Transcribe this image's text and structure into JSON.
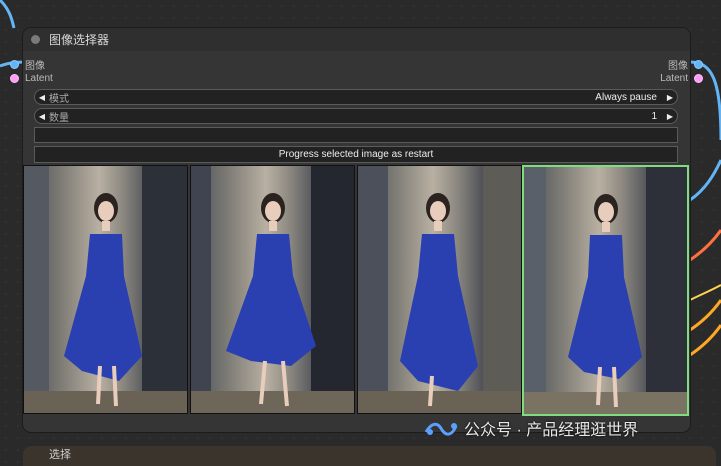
{
  "node": {
    "title": "图像选择器",
    "inputs": [
      {
        "label": "图像",
        "type": "image"
      },
      {
        "label": "Latent",
        "type": "latent"
      }
    ],
    "outputs": [
      {
        "label": "图像",
        "type": "image"
      },
      {
        "label": "Latent",
        "type": "latent"
      }
    ],
    "widgets": {
      "mode": {
        "label": "模式",
        "value": "Always pause"
      },
      "count": {
        "label": "数量",
        "value": "1"
      },
      "text_field": {
        "value": ""
      },
      "progress_button": {
        "label": "Progress selected image as restart"
      }
    },
    "gallery": {
      "image_count": 4,
      "selected_index": 4,
      "selected_color": "#7fdc7f"
    }
  },
  "next_node": {
    "title": "选择"
  },
  "watermark": {
    "text": "公众号 · 产品经理逛世界"
  },
  "colors": {
    "image_port": "#64b5f6",
    "latent_port": "#ff9cf9",
    "dress": "#2a3fb0"
  }
}
